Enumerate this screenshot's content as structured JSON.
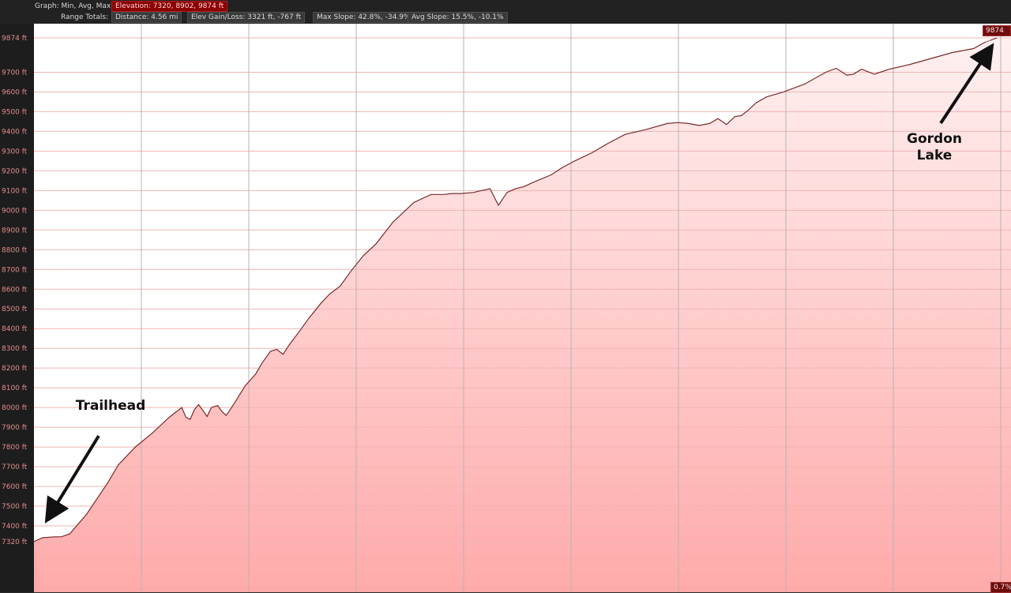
{
  "stats": {
    "graph_label": "Graph: Min, Avg, Max",
    "elevation_text": "Elevation: 7320, 8902, 9874 ft",
    "range_label": "Range Totals:",
    "distance_text": "Distance: 4.56 mi",
    "gain_text": "Elev Gain/Loss: 3321 ft, -767 ft",
    "max_slope_text": "Max Slope: 42.8%, -34.9%",
    "avg_slope_text": "Avg Slope: 15.5%, -10.1%"
  },
  "annotations": {
    "trailhead": "Trailhead",
    "gordon_lake": "Gordon\nLake"
  },
  "badges": {
    "max_elev": "9874 ft",
    "slope": "0.7%"
  },
  "colors": {
    "line": "#7a2a2a",
    "fill_top": "#fff0f0",
    "fill_bottom": "#ffaaaa",
    "grid_h": "#f0b4b4",
    "grid_v": "#b4b4b4",
    "arrow": "#111111"
  },
  "chart_data": {
    "type": "area",
    "title": "",
    "xlabel": "",
    "ylabel": "",
    "unit": "ft",
    "x_unit": "mi",
    "xlim": [
      0,
      4.56
    ],
    "ylim": [
      7320,
      9874
    ],
    "y_ticks": [
      7320,
      7400,
      7500,
      7600,
      7700,
      7800,
      7900,
      8000,
      8100,
      8200,
      8300,
      8400,
      8500,
      8600,
      8700,
      8800,
      8900,
      9000,
      9100,
      9200,
      9300,
      9400,
      9500,
      9600,
      9700,
      9874
    ],
    "y_tick_labels": [
      "7320 ft",
      "7400 ft",
      "7500 ft",
      "7600 ft",
      "7700 ft",
      "7800 ft",
      "7900 ft",
      "8000 ft",
      "8100 ft",
      "8200 ft",
      "8300 ft",
      "8400 ft",
      "8500 ft",
      "8600 ft",
      "8700 ft",
      "8800 ft",
      "8900 ft",
      "9000 ft",
      "9100 ft",
      "9200 ft",
      "9300 ft",
      "9400 ft",
      "9500 ft",
      "9600 ft",
      "9700 ft",
      "9874 ft"
    ],
    "grid": true,
    "x": [
      0,
      0.04,
      0.1,
      0.13,
      0.17,
      0.25,
      0.35,
      0.4,
      0.48,
      0.56,
      0.64,
      0.7,
      0.72,
      0.74,
      0.76,
      0.78,
      0.8,
      0.82,
      0.84,
      0.87,
      0.89,
      0.91,
      0.93,
      0.96,
      1.0,
      1.05,
      1.08,
      1.12,
      1.15,
      1.18,
      1.21,
      1.26,
      1.3,
      1.36,
      1.4,
      1.45,
      1.5,
      1.56,
      1.62,
      1.7,
      1.8,
      1.88,
      1.94,
      1.98,
      2.02,
      2.08,
      2.12,
      2.16,
      2.2,
      2.24,
      2.28,
      2.32,
      2.36,
      2.45,
      2.5,
      2.56,
      2.64,
      2.72,
      2.8,
      2.9,
      3.0,
      3.05,
      3.1,
      3.15,
      3.2,
      3.24,
      3.28,
      3.32,
      3.35,
      3.38,
      3.42,
      3.47,
      3.55,
      3.65,
      3.75,
      3.8,
      3.85,
      3.88,
      3.92,
      3.98,
      4.05,
      4.15,
      4.25,
      4.35,
      4.45,
      4.5,
      4.56
    ],
    "y": [
      7320,
      7340,
      7345,
      7345,
      7360,
      7460,
      7620,
      7710,
      7800,
      7870,
      7950,
      8000,
      7950,
      7940,
      7990,
      8015,
      7985,
      7955,
      8000,
      8010,
      7980,
      7960,
      7990,
      8040,
      8110,
      8170,
      8225,
      8285,
      8295,
      8270,
      8320,
      8390,
      8450,
      8530,
      8575,
      8615,
      8690,
      8770,
      8830,
      8940,
      9040,
      9080,
      9080,
      9085,
      9085,
      9090,
      9100,
      9110,
      9025,
      9090,
      9110,
      9120,
      9140,
      9180,
      9215,
      9250,
      9290,
      9340,
      9385,
      9410,
      9440,
      9445,
      9440,
      9430,
      9440,
      9465,
      9435,
      9475,
      9480,
      9505,
      9545,
      9575,
      9600,
      9640,
      9700,
      9720,
      9685,
      9690,
      9715,
      9690,
      9715,
      9740,
      9770,
      9800,
      9820,
      9850,
      9874
    ]
  }
}
